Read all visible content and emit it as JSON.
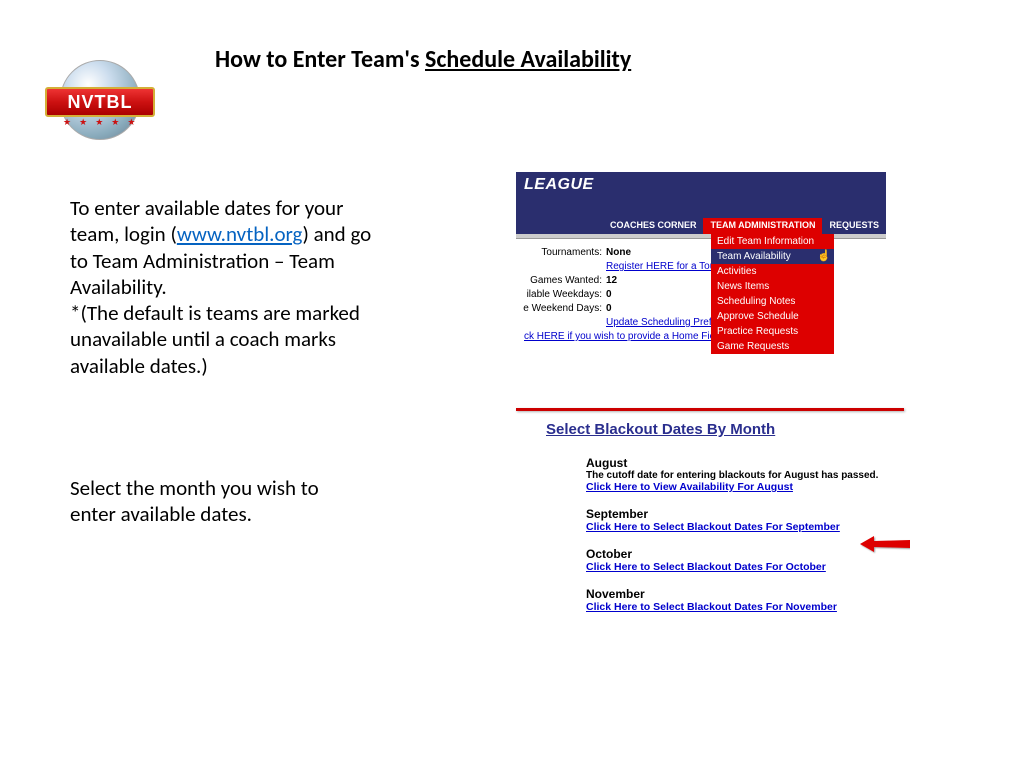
{
  "logo": {
    "text": "NVTBL"
  },
  "title": {
    "prefix": "How to Enter Team's ",
    "underlined": "Schedule Availability"
  },
  "body1": {
    "p1a": "To enter available dates for your team, login (",
    "link": "www.nvtbl.org",
    "p1b": ") and go to Team Administration – Team Availability.",
    "p2": "*(The default is teams are marked unavailable until a coach marks available dates.)"
  },
  "body2": "Select the month you wish to enter available dates.",
  "shot1": {
    "league": "LEAGUE",
    "tabs": {
      "coaches": "COACHES CORNER",
      "teamadmin": "TEAM ADMINISTRATION",
      "requests": "REQUESTS"
    },
    "dropdown": {
      "edit": "Edit Team Information",
      "avail": "Team Availability",
      "activities": "Activities",
      "news": "News Items",
      "notes": "Scheduling Notes",
      "approve": "Approve Schedule",
      "practice": "Practice Requests",
      "game": "Game Requests"
    },
    "fields": {
      "tournaments_lbl": "Tournaments:",
      "tournaments_val": "None",
      "register_link": "Register HERE for a Tou",
      "games_lbl": "Games Wanted:",
      "games_val": "12",
      "weekdays_lbl": "ilable Weekdays:",
      "weekdays_val": "0",
      "weekend_lbl": "e Weekend Days:",
      "weekend_val": "0",
      "update_link": "Update Scheduling Preferences",
      "home_link": "ck HERE if you wish to provide a Home Field."
    }
  },
  "shot2": {
    "header": "Select Blackout Dates By Month",
    "months": {
      "aug_name": "August",
      "aug_cutoff": "The cutoff date for entering blackouts for August has passed.",
      "aug_link": "Click Here to View Availability For August",
      "sep_name": "September",
      "sep_link": "Click Here to Select Blackout Dates For September",
      "oct_name": "October",
      "oct_link": "Click Here to Select Blackout Dates For October",
      "nov_name": "November",
      "nov_link": "Click Here to Select Blackout Dates For November"
    }
  }
}
